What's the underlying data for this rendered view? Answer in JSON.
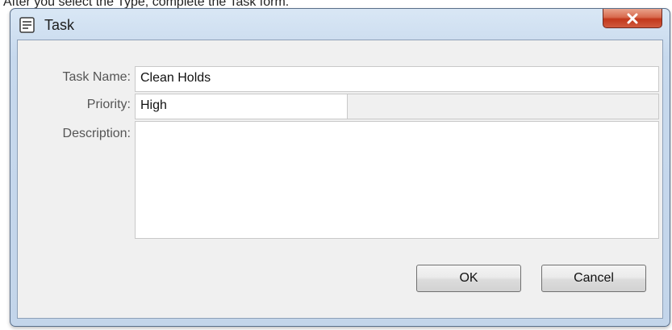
{
  "caption": "After you select the Type, complete the Task form.",
  "window": {
    "title": "Task",
    "title_icon": "form-icon",
    "close_icon": "close-x-icon"
  },
  "form": {
    "task_name_label": "Task Name:",
    "task_name_value": "Clean Holds",
    "priority_label": "Priority:",
    "priority_value": "High",
    "description_label": "Description:",
    "description_value": ""
  },
  "buttons": {
    "ok_label": "OK",
    "cancel_label": "Cancel"
  },
  "colors": {
    "close_button": "#c2381c",
    "title_bar": "#c7d9ed",
    "client_bg": "#f0f0f0"
  }
}
